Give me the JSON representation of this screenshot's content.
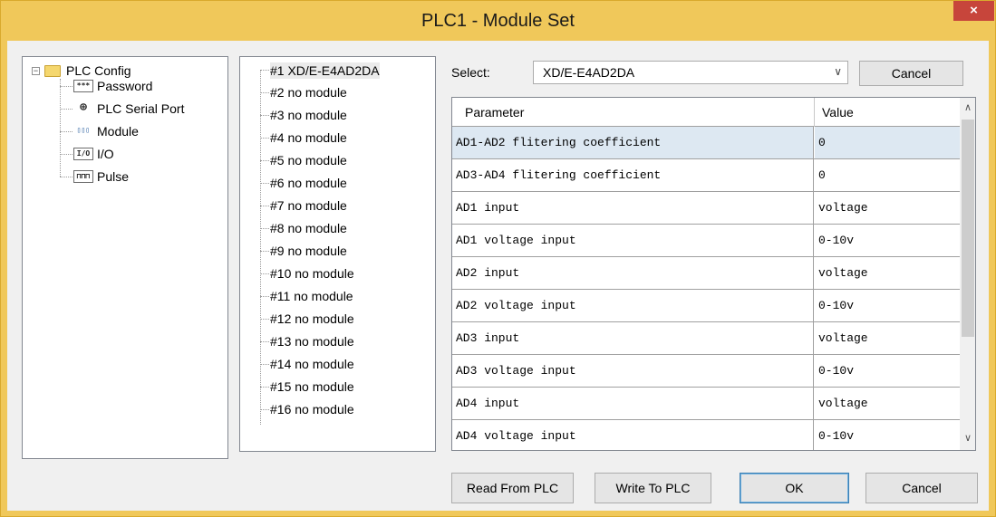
{
  "window": {
    "title": "PLC1 - Module  Set",
    "close_glyph": "×"
  },
  "config_tree": {
    "root_label": "PLC Config",
    "root_expander": "−",
    "items": [
      {
        "label": "Password",
        "icon": "password-icon",
        "icon_text": "***"
      },
      {
        "label": "PLC Serial Port",
        "icon": "serial-port-icon",
        "icon_text": "⊕"
      },
      {
        "label": "Module",
        "icon": "module-icon",
        "icon_text": "▯▯▯"
      },
      {
        "label": "I/O",
        "icon": "io-icon",
        "icon_text": "I/O"
      },
      {
        "label": "Pulse",
        "icon": "pulse-icon",
        "icon_text": "⊓⊓⊓"
      }
    ]
  },
  "module_list": {
    "items": [
      "#1 XD/E-E4AD2DA",
      "#2 no module",
      "#3 no module",
      "#4 no module",
      "#5 no module",
      "#6 no module",
      "#7 no module",
      "#8 no module",
      "#9 no module",
      "#10 no module",
      "#11 no module",
      "#12 no module",
      "#13 no module",
      "#14 no module",
      "#15 no module",
      "#16 no module"
    ]
  },
  "select": {
    "label": "Select:",
    "value": "XD/E-E4AD2DA",
    "cancel_label": "Cancel"
  },
  "grid": {
    "col_parameter": "Parameter",
    "col_value": "Value",
    "rows": [
      {
        "param": "AD1-AD2 flitering coefficient",
        "value": "0"
      },
      {
        "param": "AD3-AD4 flitering coefficient",
        "value": "0"
      },
      {
        "param": "AD1 input",
        "value": "voltage"
      },
      {
        "param": "AD1 voltage input",
        "value": "0-10v"
      },
      {
        "param": "AD2 input",
        "value": "voltage"
      },
      {
        "param": "AD2 voltage input",
        "value": "0-10v"
      },
      {
        "param": "AD3 input",
        "value": "voltage"
      },
      {
        "param": "AD3 voltage input",
        "value": "0-10v"
      },
      {
        "param": "AD4 input",
        "value": "voltage"
      },
      {
        "param": "AD4 voltage input",
        "value": "0-10v"
      }
    ]
  },
  "footer": {
    "read_label": "Read From PLC",
    "write_label": "Write To PLC",
    "ok_label": "OK",
    "cancel_label": "Cancel"
  },
  "colors": {
    "title_bar": "#f0c85a",
    "close_button": "#c7453b",
    "selection": "#dde8f2"
  }
}
